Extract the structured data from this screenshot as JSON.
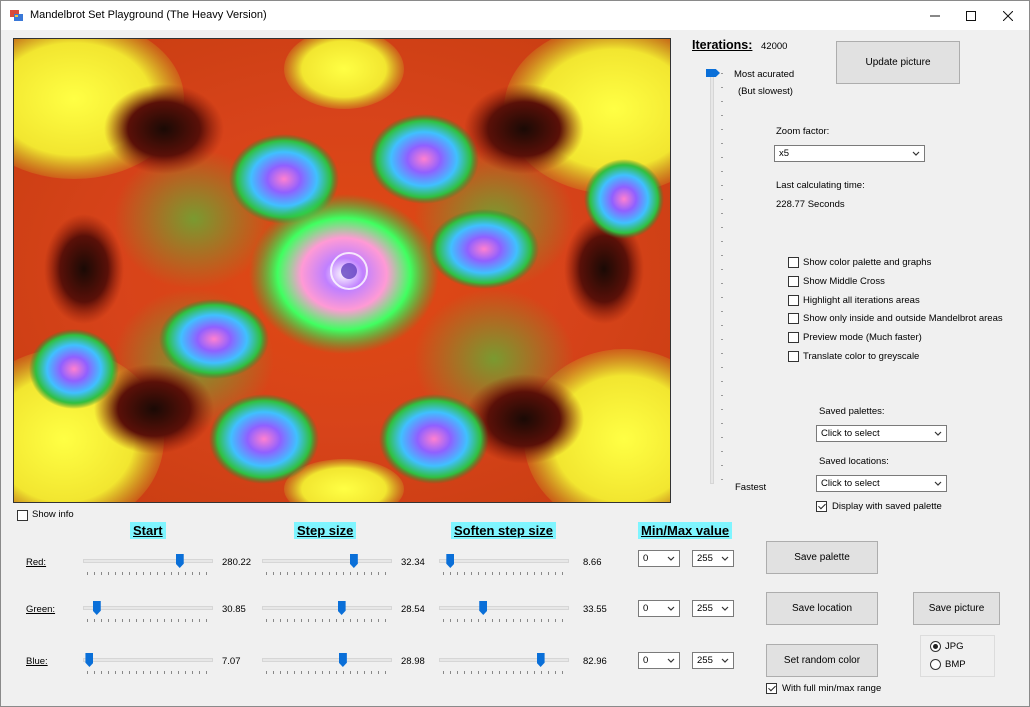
{
  "window": {
    "title": "Mandelbrot Set Playground (The Heavy Version)"
  },
  "iterations": {
    "label": "Iterations:",
    "value": "42000",
    "top_label": "Most acurated",
    "top_sub": "(But slowest)",
    "bottom_label": "Fastest",
    "slider_fraction": 1.0
  },
  "update_button": "Update picture",
  "zoom": {
    "label": "Zoom factor:",
    "selected": "x5"
  },
  "calc_time": {
    "label": "Last calculating time:",
    "value": "228.77 Seconds"
  },
  "options": [
    {
      "label": "Show color palette and graphs",
      "checked": false
    },
    {
      "label": "Show Middle Cross",
      "checked": false
    },
    {
      "label": "Highlight all iterations areas",
      "checked": false
    },
    {
      "label": "Show only inside and outside Mandelbrot areas",
      "checked": false
    },
    {
      "label": "Preview mode (Much faster)",
      "checked": false
    },
    {
      "label": "Translate color to greyscale",
      "checked": false
    }
  ],
  "saved_palettes": {
    "label": "Saved palettes:",
    "selected": "Click to select"
  },
  "saved_locations": {
    "label": "Saved locations:",
    "selected": "Click to select"
  },
  "display_saved_palette": {
    "label": "Display with saved palette",
    "checked": true
  },
  "show_info": {
    "label": "Show info",
    "checked": false
  },
  "columns": {
    "start": "Start",
    "step": "Step size",
    "soften": "Soften step size",
    "minmax": "Min/Max value"
  },
  "channels": [
    {
      "name": "Red:",
      "start": "280.22",
      "start_pos": 0.76,
      "step": "32.34",
      "step_pos": 0.72,
      "soften": "8.66",
      "soften_pos": 0.06,
      "min": "0",
      "max": "255"
    },
    {
      "name": "Green:",
      "start": "30.85",
      "start_pos": 0.08,
      "step": "28.54",
      "step_pos": 0.62,
      "soften": "33.55",
      "soften_pos": 0.33,
      "min": "0",
      "max": "255"
    },
    {
      "name": "Blue:",
      "start": "7.07",
      "start_pos": 0.02,
      "step": "28.98",
      "step_pos": 0.63,
      "soften": "82.96",
      "soften_pos": 0.8,
      "min": "0",
      "max": "255"
    }
  ],
  "buttons": {
    "save_palette": "Save  palette",
    "save_location": "Save location",
    "save_picture": "Save picture",
    "random_color": "Set random color"
  },
  "full_range": {
    "label": "With full min/max range",
    "checked": true
  },
  "format": {
    "jpg": "JPG",
    "bmp": "BMP",
    "selected": "JPG"
  },
  "colors": {
    "accent": "#0a6fd8",
    "heading_bg": "#7ff5ff"
  }
}
